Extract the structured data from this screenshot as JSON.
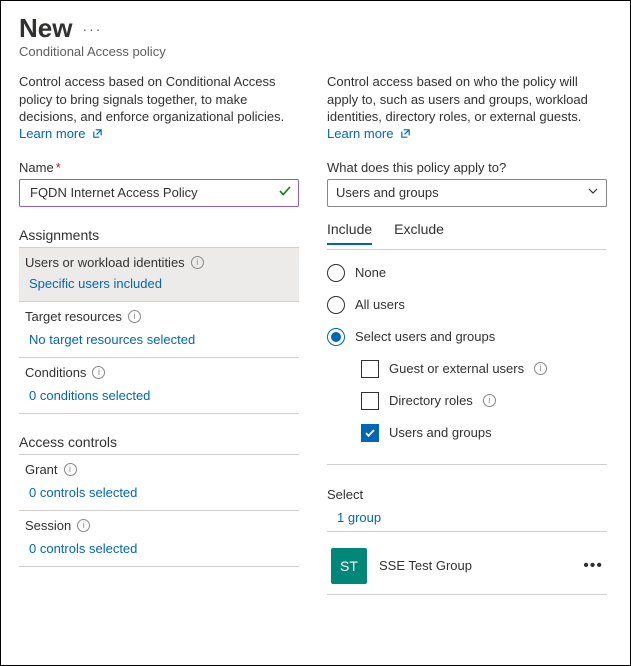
{
  "header": {
    "title": "New",
    "menu_glyph": "···",
    "subtitle": "Conditional Access policy"
  },
  "left": {
    "description": "Control access based on Conditional Access policy to bring signals together, to make decisions, and enforce organizational policies.",
    "learn_more": "Learn more",
    "name_label": "Name",
    "name_value": "FQDN Internet Access Policy",
    "sections": {
      "assignments": "Assignments",
      "access_controls": "Access controls"
    },
    "rows": {
      "users": {
        "label": "Users or workload identities",
        "link": "Specific users included"
      },
      "target": {
        "label": "Target resources",
        "link": "No target resources selected"
      },
      "conditions": {
        "label": "Conditions",
        "link": "0 conditions selected"
      },
      "grant": {
        "label": "Grant",
        "link": "0 controls selected"
      },
      "session": {
        "label": "Session",
        "link": "0 controls selected"
      }
    }
  },
  "right": {
    "description": "Control access based on who the policy will apply to, such as users and groups, workload identities, directory roles, or external guests.",
    "learn_more": "Learn more",
    "apply_label": "What does this policy apply to?",
    "dropdown_value": "Users and groups",
    "tabs": {
      "include": "Include",
      "exclude": "Exclude"
    },
    "options": {
      "none": "None",
      "all": "All users",
      "select": "Select users and groups",
      "guest": "Guest or external users",
      "dir_roles": "Directory roles",
      "users_groups": "Users and groups"
    },
    "select": {
      "label": "Select",
      "link": "1 group",
      "group_initials": "ST",
      "group_name": "SSE Test Group",
      "menu_glyph": "•••"
    }
  }
}
